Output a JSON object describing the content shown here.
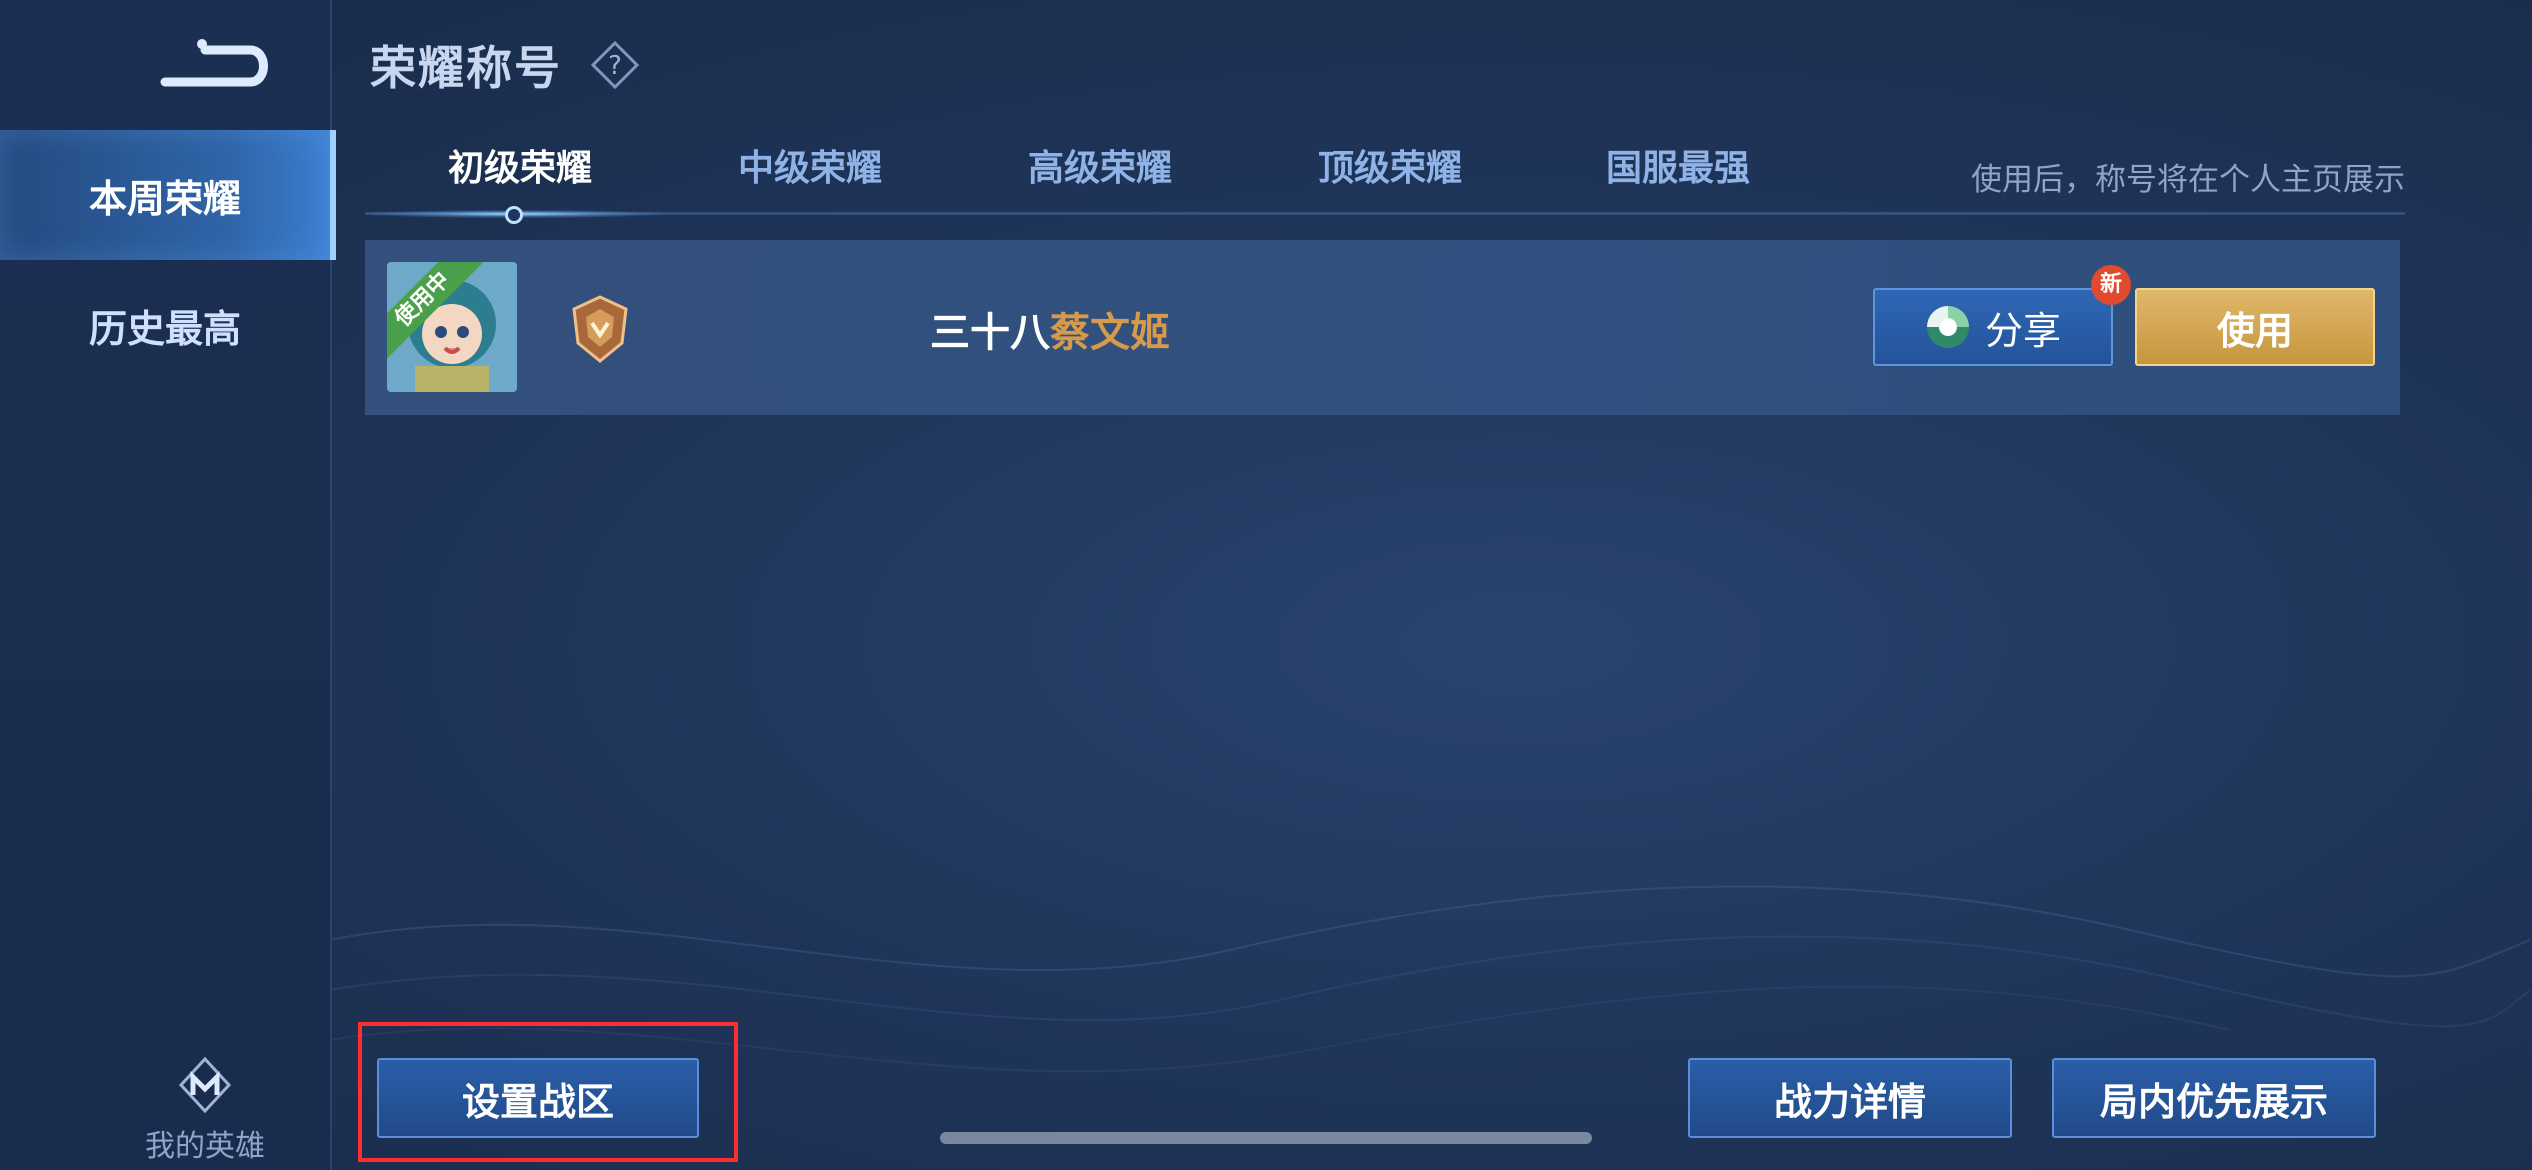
{
  "sidebar": {
    "items": [
      {
        "label": "本周荣耀",
        "active": true
      },
      {
        "label": "历史最高",
        "active": false
      }
    ],
    "footer_label": "我的英雄"
  },
  "header": {
    "title": "荣耀称号"
  },
  "tabs": [
    {
      "label": "初级荣耀",
      "active": true
    },
    {
      "label": "中级荣耀",
      "active": false
    },
    {
      "label": "高级荣耀",
      "active": false
    },
    {
      "label": "顶级荣耀",
      "active": false
    },
    {
      "label": "国服最强",
      "active": false
    }
  ],
  "tab_hint": "使用后，称号将在个人主页展示",
  "row": {
    "in_use_label": "使用中",
    "title_prefix": "三十八",
    "hero_name": "蔡文姬",
    "share_label": "分享",
    "new_badge": "新",
    "use_label": "使用"
  },
  "bottom": {
    "set_zone": "设置战区",
    "power_detail": "战力详情",
    "ingame_show": "局内优先展示"
  },
  "colors": {
    "hero_name": "#d69a4a",
    "use_button": "#c6963f",
    "highlight": "#ff2e2e",
    "in_use_ribbon": "#4aa04a"
  }
}
